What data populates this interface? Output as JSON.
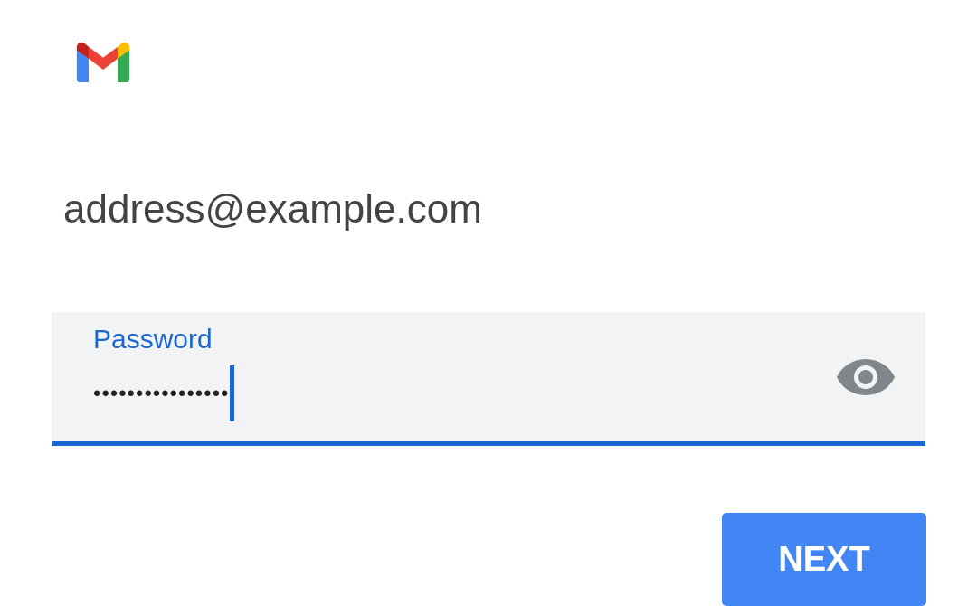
{
  "account": {
    "email": "address@example.com"
  },
  "password_field": {
    "label": "Password",
    "value": "••••••••••••••••",
    "focused": true
  },
  "buttons": [
    {
      "label": "NEXT"
    }
  ]
}
